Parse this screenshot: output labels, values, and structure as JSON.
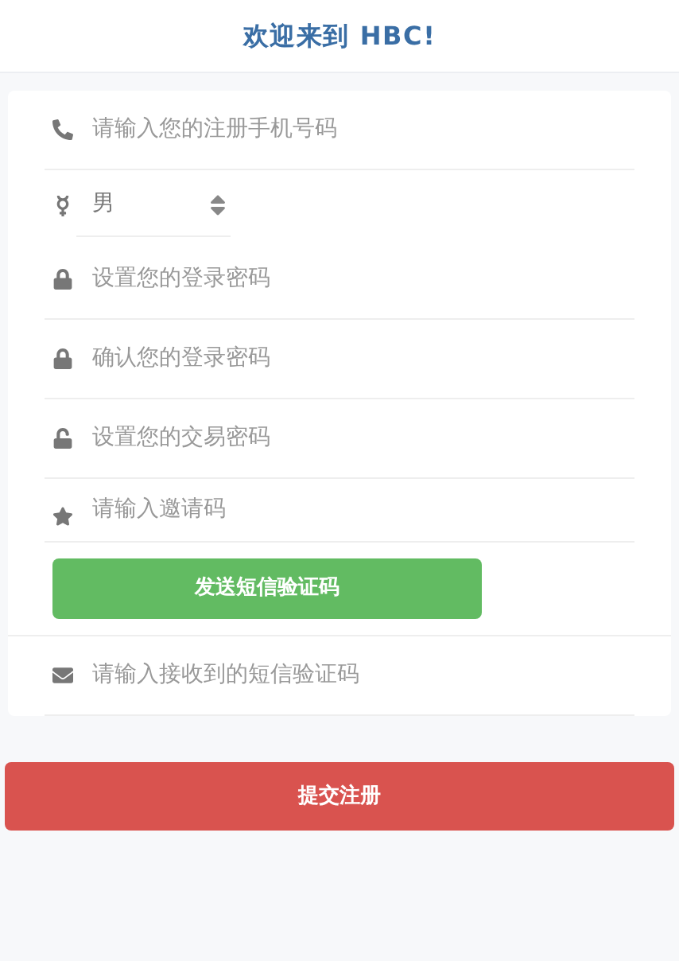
{
  "header": {
    "title": "欢迎来到 HBC!"
  },
  "fields": [
    {
      "kind": "phone",
      "placeholder": "请输入您的注册手机号码"
    },
    {
      "kind": "gender",
      "value": "男"
    },
    {
      "kind": "lock",
      "placeholder": "设置您的登录密码"
    },
    {
      "kind": "lock",
      "placeholder": "确认您的登录密码"
    },
    {
      "kind": "unlock",
      "placeholder": "设置您的交易密码"
    },
    {
      "kind": "star",
      "placeholder": "请输入邀请码"
    }
  ],
  "send_code_button": "发送短信验证码",
  "code_field": {
    "kind": "envelope",
    "placeholder": "请输入接收到的短信验证码"
  },
  "submit_button": "提交注册"
}
